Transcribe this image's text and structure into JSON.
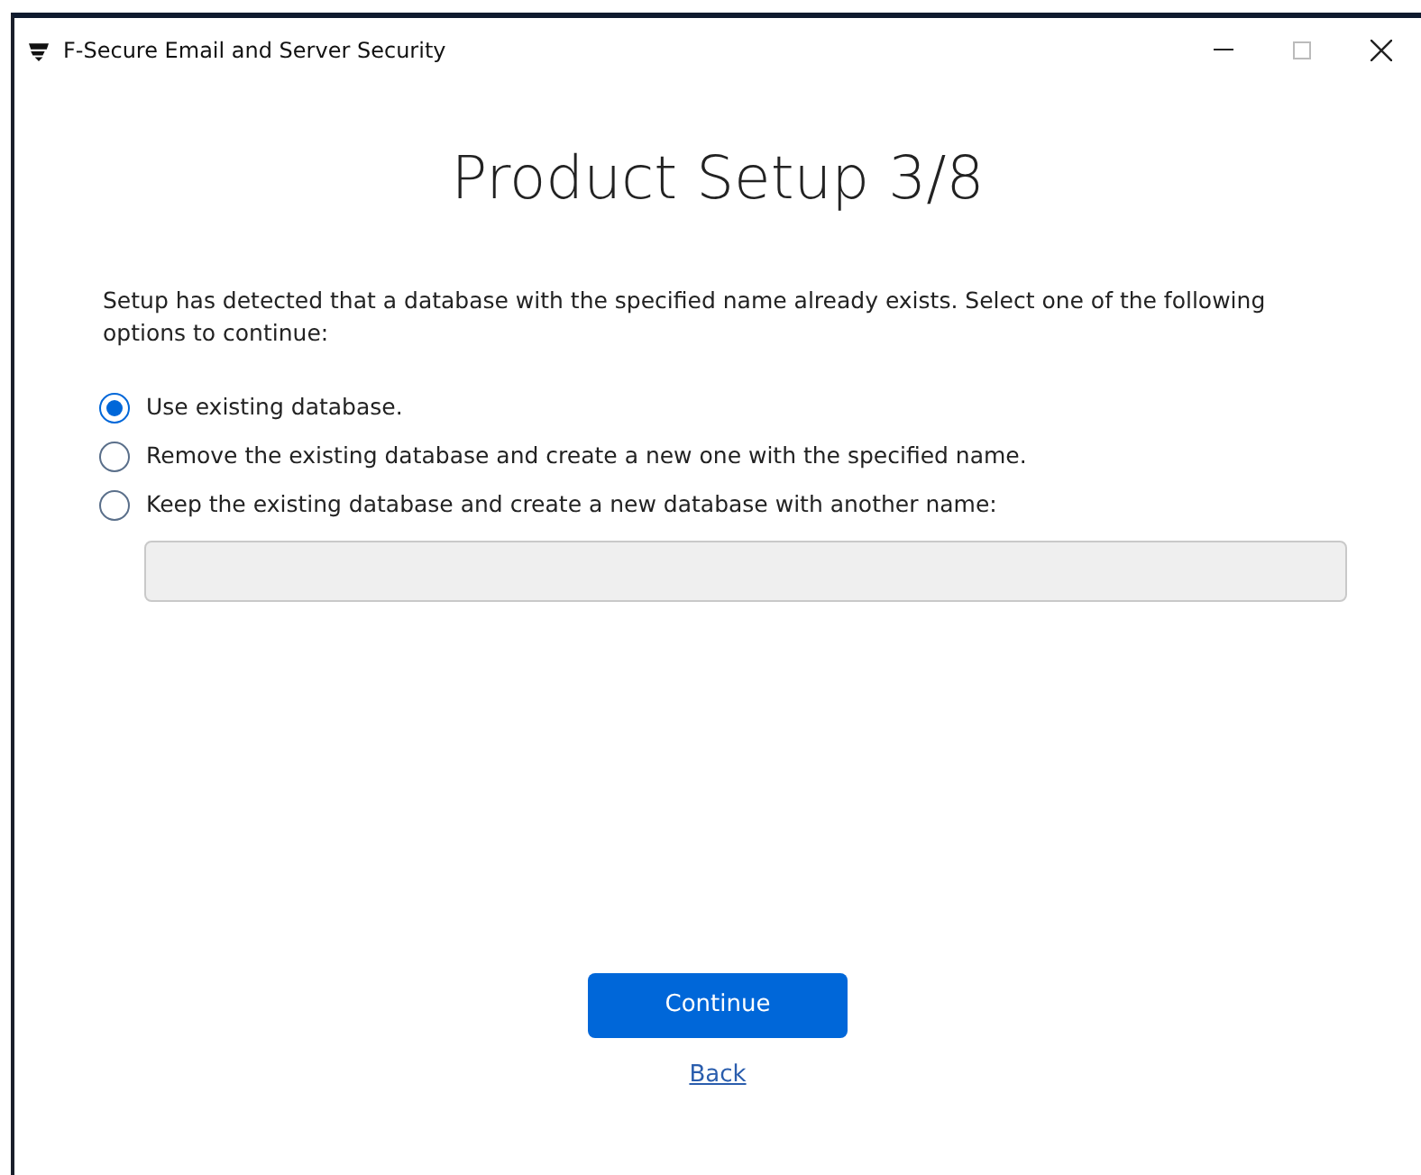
{
  "window": {
    "title": "F-Secure Email and Server Security"
  },
  "heading": "Product Setup 3/8",
  "message": "Setup has detected that a database with the specified name already exists. Select one of the following options to continue:",
  "options": [
    {
      "label": "Use existing database.",
      "selected": true
    },
    {
      "label": "Remove the existing database and create a new one with the specified name.",
      "selected": false
    },
    {
      "label": "Keep the existing database and create a new database with another name:",
      "selected": false
    }
  ],
  "name_field": {
    "disabled": true
  },
  "buttons": {
    "continue": "Continue",
    "back": "Back"
  }
}
